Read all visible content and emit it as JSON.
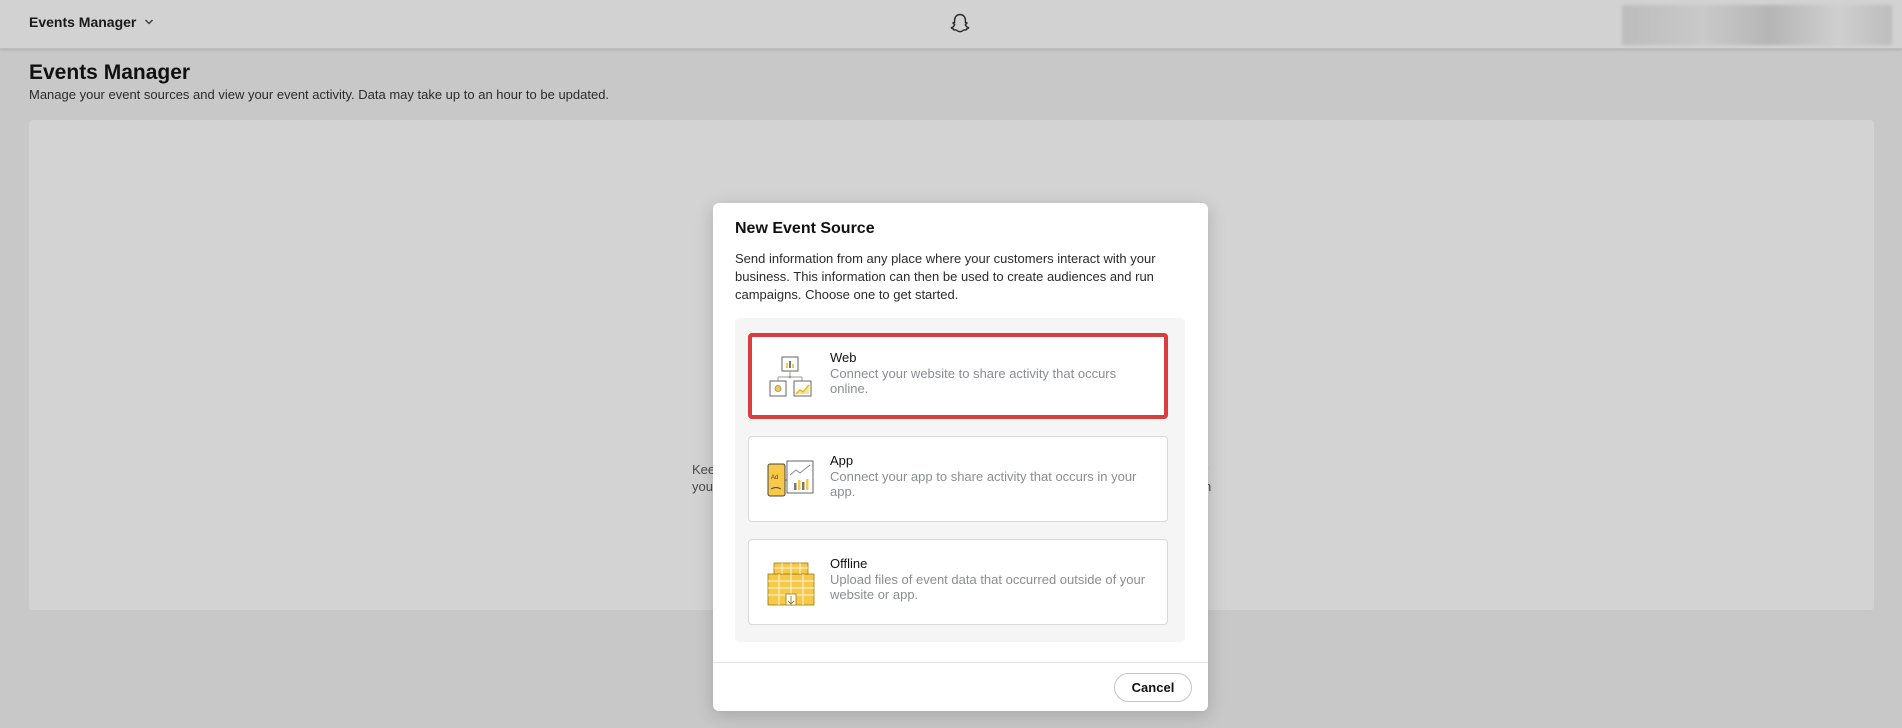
{
  "topbar": {
    "app_name": "Events Manager",
    "logo_icon": "snapchat-ghost-icon",
    "switcher_icon": "chevron-down-icon"
  },
  "page": {
    "title": "Events Manager",
    "subtitle": "Manage your event sources and view your event activity. Data may take up to an hour to be updated.",
    "bg_fragments": [
      {
        "line1": "Kee",
        "line2": "you"
      },
      {
        "line1": "r",
        "line2": "n"
      }
    ]
  },
  "modal": {
    "title": "New Event Source",
    "description": "Send information from any place where your customers interact with your business. This information can then be used to create audiences and run campaigns. Choose one to get started.",
    "options": [
      {
        "title": "Web",
        "description": "Connect your website to share activity that occurs online.",
        "icon": "web-diagram-icon",
        "selected": true
      },
      {
        "title": "App",
        "description": "Connect your app to share activity that occurs in your app.",
        "icon": "app-phone-chart-icon",
        "selected": false
      },
      {
        "title": "Offline",
        "description": "Upload files of event data that occurred outside of your website or app.",
        "icon": "store-building-icon",
        "selected": false
      }
    ],
    "cancel_label": "Cancel"
  },
  "colors": {
    "accent_selected_border": "#d93d3d",
    "brand_yellow": "#f7c948"
  }
}
